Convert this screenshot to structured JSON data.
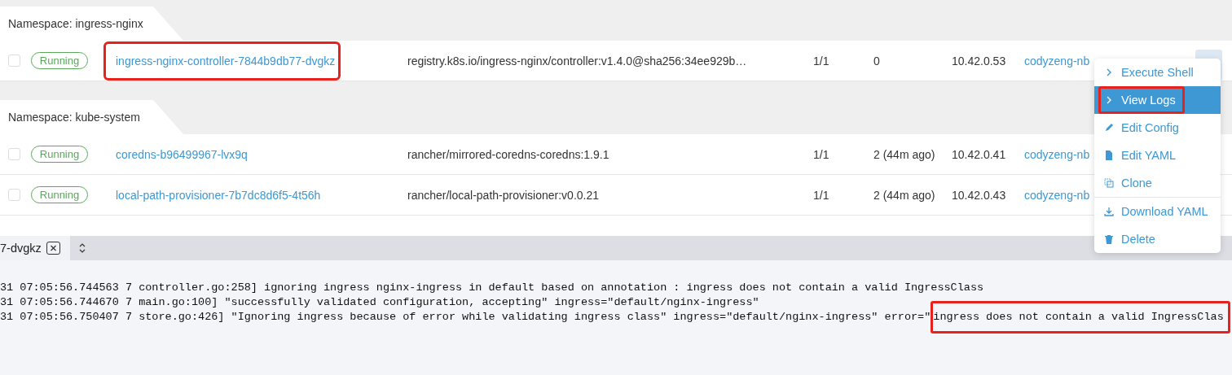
{
  "namespaces": [
    {
      "label": "Namespace: ingress-nginx",
      "pods": [
        {
          "checked": false,
          "state": "Running",
          "name": "ingress-nginx-controller-7844b9db77-dvgkz",
          "image": "registry.k8s.io/ingress-nginx/controller:v1.4.0@sha256:34ee929b…",
          "ready": "1/1",
          "restarts": "0",
          "ip": "10.42.0.53",
          "node": "codyzeng-nb",
          "annotated": true
        }
      ]
    },
    {
      "label": "Namespace: kube-system",
      "pods": [
        {
          "checked": false,
          "state": "Running",
          "name": "coredns-b96499967-lvx9q",
          "image": "rancher/mirrored-coredns-coredns:1.9.1",
          "ready": "1/1",
          "restarts": "2 (44m ago)",
          "ip": "10.42.0.41",
          "node": "codyzeng-nb",
          "annotated": false
        },
        {
          "checked": false,
          "state": "Running",
          "name": "local-path-provisioner-7b7dc8d6f5-4t56h",
          "image": "rancher/local-path-provisioner:v0.0.21",
          "ready": "1/1",
          "restarts": "2 (44m ago)",
          "ip": "10.42.0.43",
          "node": "codyzeng-nb",
          "annotated": false
        }
      ]
    }
  ],
  "action_menu": {
    "items": [
      {
        "label": "Execute Shell",
        "selected": false,
        "annotated": false,
        "divider_before": false
      },
      {
        "label": "View Logs",
        "selected": true,
        "annotated": true,
        "divider_before": false
      },
      {
        "label": "Edit Config",
        "selected": false,
        "annotated": false,
        "divider_before": false
      },
      {
        "label": "Edit YAML",
        "selected": false,
        "annotated": false,
        "divider_before": false
      },
      {
        "label": "Clone",
        "selected": false,
        "annotated": false,
        "divider_before": false
      },
      {
        "label": "Download YAML",
        "selected": false,
        "annotated": false,
        "divider_before": true
      },
      {
        "label": "Delete",
        "selected": false,
        "annotated": false,
        "divider_before": false
      }
    ]
  },
  "log_panel": {
    "tab": {
      "label": "7-dvgkz"
    },
    "lines": [
      {
        "text": "31 07:05:56.744563 7 controller.go:258] ignoring ingress nginx-ingress in default based on annotation : ingress does not contain a valid IngressClass"
      },
      {
        "text": "31 07:05:56.744670 7 main.go:100] \"successfully validated configuration, accepting\" ingress=\"default/nginx-ingress\""
      },
      {
        "text": "31 07:05:56.750407 7 store.go:426] \"Ignoring ingress because of error while validating ingress class\" ingress=\"default/nginx-ingress\" error=\"",
        "highlight": "ingress does not contain a valid IngressClas"
      }
    ]
  }
}
